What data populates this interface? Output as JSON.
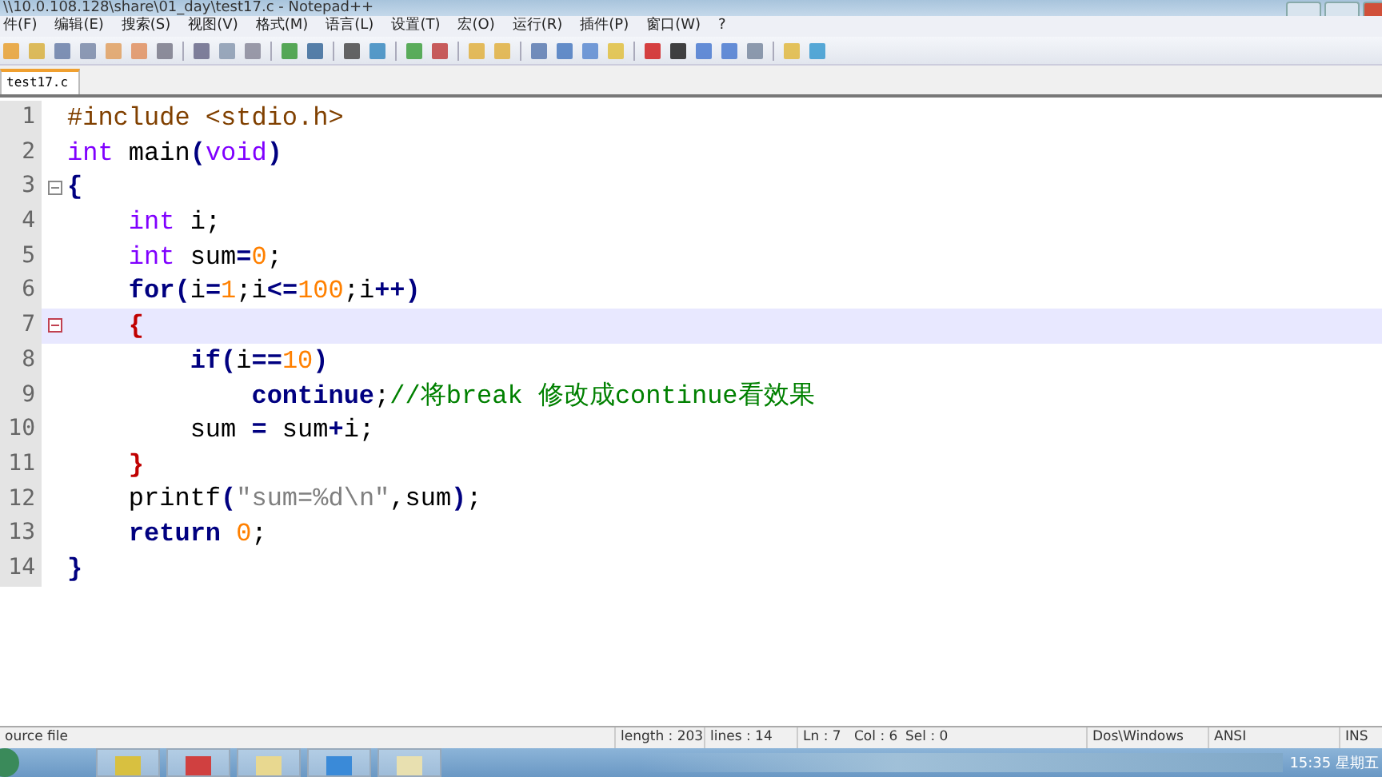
{
  "window": {
    "title": "\\\\10.0.108.128\\share\\01_day\\test17.c - Notepad++"
  },
  "menu": [
    "件(F)",
    "编辑(E)",
    "搜索(S)",
    "视图(V)",
    "格式(M)",
    "语言(L)",
    "设置(T)",
    "宏(O)",
    "运行(R)",
    "插件(P)",
    "窗口(W)",
    "?"
  ],
  "tabs": [
    {
      "label": "test17.c",
      "selected": true
    }
  ],
  "editor": {
    "lines": [
      {
        "number": "1",
        "current": false,
        "foldable": false,
        "tokens": [
          {
            "kind": "pre",
            "text": "#include <stdio.h>"
          }
        ]
      },
      {
        "number": "2",
        "current": false,
        "foldable": false,
        "tokens": [
          {
            "kind": "type",
            "text": "int"
          },
          {
            "kind": "plain",
            "text": " main"
          },
          {
            "kind": "op",
            "text": "("
          },
          {
            "kind": "type",
            "text": "void"
          },
          {
            "kind": "op",
            "text": ")"
          }
        ]
      },
      {
        "number": "3",
        "current": false,
        "foldable": true,
        "tokens": [
          {
            "kind": "op",
            "text": "{"
          }
        ]
      },
      {
        "number": "4",
        "current": false,
        "foldable": false,
        "tokens": [
          {
            "kind": "type",
            "text": "    int"
          },
          {
            "kind": "plain",
            "text": " i;"
          }
        ]
      },
      {
        "number": "5",
        "current": false,
        "foldable": false,
        "tokens": [
          {
            "kind": "type",
            "text": "    int"
          },
          {
            "kind": "plain",
            "text": " sum"
          },
          {
            "kind": "op",
            "text": "="
          },
          {
            "kind": "num",
            "text": "0"
          },
          {
            "kind": "plain",
            "text": ";"
          }
        ]
      },
      {
        "number": "6",
        "current": false,
        "foldable": false,
        "tokens": [
          {
            "kind": "kw",
            "text": "    for"
          },
          {
            "kind": "op",
            "text": "("
          },
          {
            "kind": "plain",
            "text": "i"
          },
          {
            "kind": "op",
            "text": "="
          },
          {
            "kind": "num",
            "text": "1"
          },
          {
            "kind": "plain",
            "text": ";i"
          },
          {
            "kind": "op",
            "text": "<="
          },
          {
            "kind": "num",
            "text": "100"
          },
          {
            "kind": "plain",
            "text": ";i"
          },
          {
            "kind": "op",
            "text": "++)"
          }
        ]
      },
      {
        "number": "7",
        "current": true,
        "foldable": true,
        "tokens": [
          {
            "kind": "brace",
            "text": "    {"
          }
        ]
      },
      {
        "number": "8",
        "current": false,
        "foldable": false,
        "tokens": [
          {
            "kind": "kw",
            "text": "        if"
          },
          {
            "kind": "op",
            "text": "("
          },
          {
            "kind": "plain",
            "text": "i"
          },
          {
            "kind": "op",
            "text": "=="
          },
          {
            "kind": "num",
            "text": "10"
          },
          {
            "kind": "op",
            "text": ")"
          }
        ]
      },
      {
        "number": "9",
        "current": false,
        "foldable": false,
        "tokens": [
          {
            "kind": "kw",
            "text": "            continue"
          },
          {
            "kind": "plain",
            "text": ";"
          },
          {
            "kind": "comment",
            "text": "//将break 修改成continue看效果"
          }
        ]
      },
      {
        "number": "10",
        "current": false,
        "foldable": false,
        "tokens": [
          {
            "kind": "plain",
            "text": "        sum "
          },
          {
            "kind": "op",
            "text": "="
          },
          {
            "kind": "plain",
            "text": " sum"
          },
          {
            "kind": "op",
            "text": "+"
          },
          {
            "kind": "plain",
            "text": "i;"
          }
        ]
      },
      {
        "number": "11",
        "current": false,
        "foldable": false,
        "tokens": [
          {
            "kind": "brace",
            "text": "    }"
          }
        ]
      },
      {
        "number": "12",
        "current": false,
        "foldable": false,
        "tokens": [
          {
            "kind": "plain",
            "text": "    printf"
          },
          {
            "kind": "op",
            "text": "("
          },
          {
            "kind": "str",
            "text": "\"sum=%d\\n\""
          },
          {
            "kind": "plain",
            "text": ",sum"
          },
          {
            "kind": "op",
            "text": ")"
          },
          {
            "kind": "plain",
            "text": ";"
          }
        ]
      },
      {
        "number": "13",
        "current": false,
        "foldable": false,
        "tokens": [
          {
            "kind": "kw",
            "text": "    return "
          },
          {
            "kind": "num",
            "text": "0"
          },
          {
            "kind": "plain",
            "text": ";"
          }
        ]
      },
      {
        "number": "14",
        "current": false,
        "foldable": false,
        "tokens": [
          {
            "kind": "op",
            "text": "}"
          }
        ]
      }
    ]
  },
  "status_bar": {
    "file_type": "ource file",
    "length": "length : 203",
    "lines": "lines : 14",
    "ln": "Ln : 7",
    "col": "Col : 6",
    "sel": "Sel : 0",
    "eol": "Dos\\Windows",
    "encoding": "ANSI",
    "mode": "INS"
  },
  "taskbar": {
    "clock": "15:35 星期五"
  }
}
